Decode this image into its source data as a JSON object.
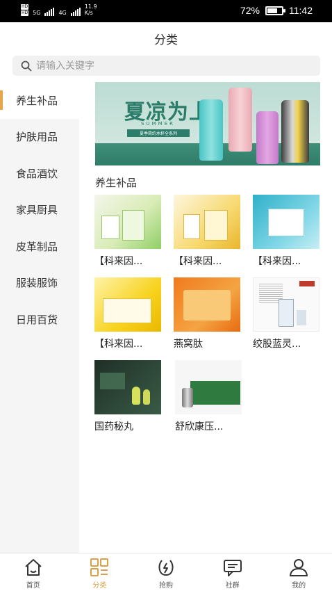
{
  "status_bar": {
    "hd1": "HD",
    "hd2": "HD",
    "net1": "5G",
    "net2": "4G",
    "speed_value": "11.9",
    "speed_unit": "K/s",
    "battery_percent": 72,
    "battery_label": "72%",
    "time": "11:42"
  },
  "header": {
    "title": "分类"
  },
  "search": {
    "placeholder": "请输入关键字",
    "icon": "search-icon"
  },
  "sidebar": {
    "items": [
      {
        "label": "养生补品",
        "active": true
      },
      {
        "label": "护肤用品",
        "active": false
      },
      {
        "label": "食品酒饮",
        "active": false
      },
      {
        "label": "家具厨具",
        "active": false
      },
      {
        "label": "皮革制品",
        "active": false
      },
      {
        "label": "服装服饰",
        "active": false
      },
      {
        "label": "日用百货",
        "active": false
      }
    ]
  },
  "banner": {
    "title": "夏凉为上",
    "subtitle": "SUMMER",
    "tag": "夏季简约水杯全系列"
  },
  "section": {
    "title": "养生补品"
  },
  "products": [
    {
      "name": "【科来因..."
    },
    {
      "name": "【科来因..."
    },
    {
      "name": "【科来因..."
    },
    {
      "name": "【科来因..."
    },
    {
      "name": "燕窝肽"
    },
    {
      "name": "绞股蓝灵..."
    },
    {
      "name": "国药秘丸"
    },
    {
      "name": "舒欣康压..."
    }
  ],
  "tabbar": {
    "items": [
      {
        "label": "首页",
        "icon": "home-icon",
        "active": false
      },
      {
        "label": "分类",
        "icon": "category-grid-icon",
        "active": true
      },
      {
        "label": "抢购",
        "icon": "flash-sale-icon",
        "active": false
      },
      {
        "label": "社群",
        "icon": "chat-icon",
        "active": false
      },
      {
        "label": "我的",
        "icon": "user-icon",
        "active": false
      }
    ]
  },
  "colors": {
    "accent": "#e8a64a",
    "banner_green": "#2b7d6a",
    "sidebar_bg": "#f5f5f5"
  }
}
